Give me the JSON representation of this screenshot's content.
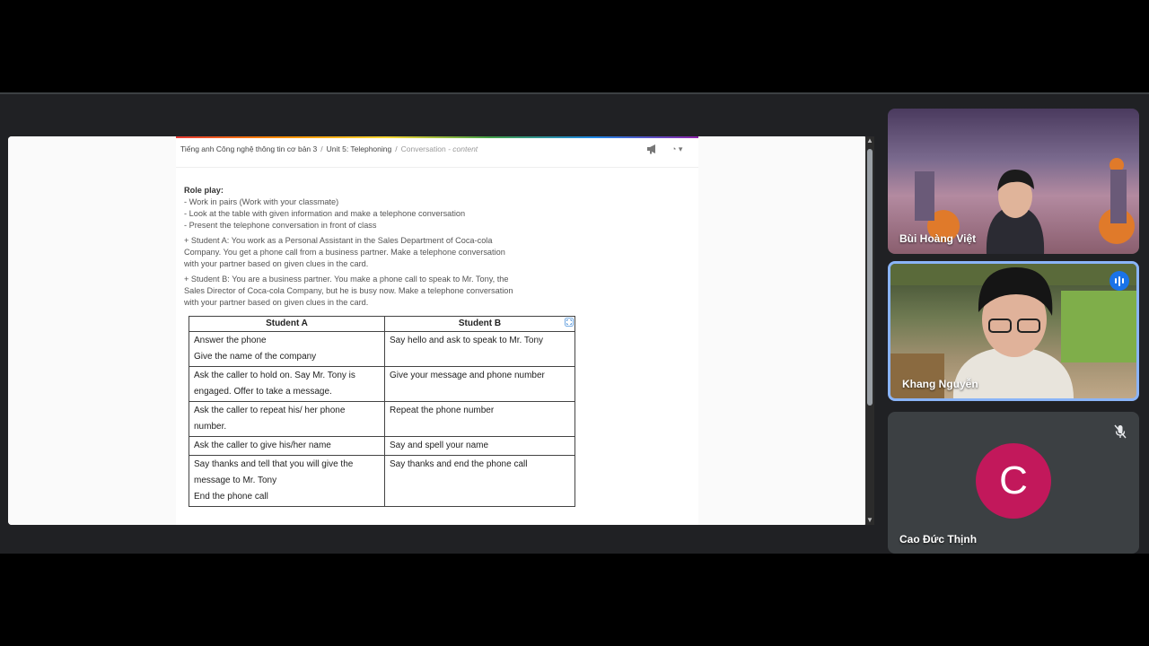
{
  "breadcrumb": {
    "course": "Tiếng anh Công nghệ thông tin cơ bản 3",
    "unit": "Unit 5: Telephoning",
    "page": "Conversation",
    "page_suffix": "- content"
  },
  "roleplay": {
    "title": "Role play:",
    "bullets": [
      "- Work in pairs (Work with your classmate)",
      "- Look at the table with given information and make a telephone conversation",
      "- Present the telephone conversation in front of class"
    ],
    "student_a_lines": [
      "+ Student A: You work as a Personal Assistant in the Sales Department of Coca-cola",
      "Company. You get a phone call from a business partner. Make a telephone conversation",
      "with your partner based on given clues in the card."
    ],
    "student_b_lines": [
      "+ Student B: You are a business partner. You make a phone call to speak to Mr. Tony, the",
      "Sales Director of Coca-cola Company, but he is busy now. Make a telephone conversation",
      "with your partner based on given clues in the card."
    ]
  },
  "table": {
    "headers": [
      "Student A",
      "Student B"
    ],
    "rows": [
      {
        "a": [
          "Answer the phone",
          "Give the name of the company"
        ],
        "b": [
          "Say hello and ask to speak to Mr. Tony"
        ]
      },
      {
        "a": [
          "Ask the caller to hold on. Say Mr. Tony is",
          "engaged. Offer to take a message."
        ],
        "b": [
          "Give your message and phone number"
        ]
      },
      {
        "a": [
          "Ask the caller to repeat his/ her phone",
          "number."
        ],
        "b": [
          "Repeat the phone number"
        ]
      },
      {
        "a": [
          "Ask the caller to give his/her name"
        ],
        "b": [
          "Say and spell your name"
        ]
      },
      {
        "a": [
          "Say thanks and tell that you will give the",
          "message to Mr. Tony",
          "End the phone call"
        ],
        "b": [
          "Say thanks and end the phone call"
        ]
      }
    ]
  },
  "participants": [
    {
      "name": "Bùi Hoàng Việt"
    },
    {
      "name": "Khang Nguyễn",
      "speaking": true
    },
    {
      "name": "Cao Đức Thịnh",
      "initial": "C",
      "avatar_color": "#c2185b",
      "muted": true
    }
  ],
  "icons": {
    "announce": "megaphone-icon",
    "expand": "fullscreen-icon",
    "mic_off": "mic-off-icon",
    "speaking": "audio-level-icon"
  }
}
